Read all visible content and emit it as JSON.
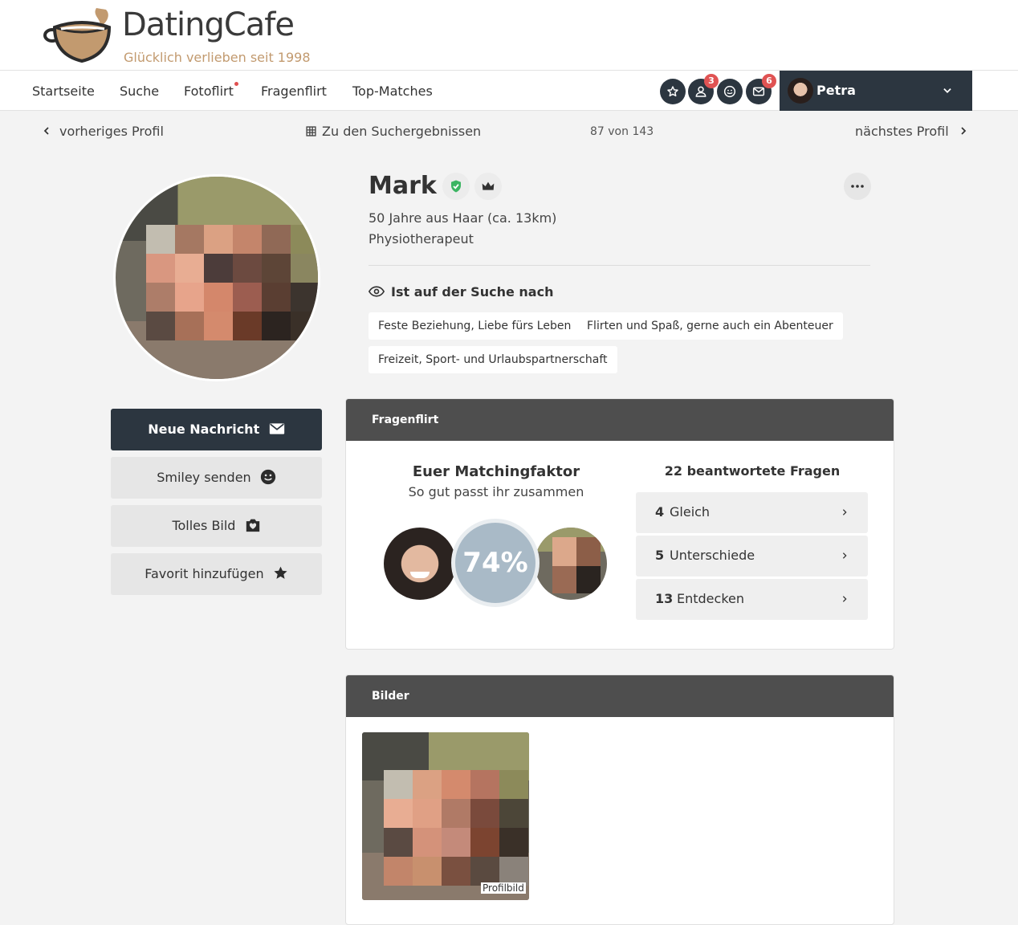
{
  "brand": {
    "name": "DatingCafe",
    "tagline": "Glücklich verlieben seit 1998"
  },
  "nav": {
    "items": [
      {
        "label": "Startseite"
      },
      {
        "label": "Suche"
      },
      {
        "label": "Fotoflirt"
      },
      {
        "label": "Fragenflirt"
      },
      {
        "label": "Top-Matches"
      }
    ],
    "icons": [
      {
        "name": "star-icon",
        "badge": ""
      },
      {
        "name": "user-icon",
        "badge": "3"
      },
      {
        "name": "smiley-icon",
        "badge": ""
      },
      {
        "name": "mail-icon",
        "badge": "6"
      }
    ],
    "user": {
      "name": "Petra"
    }
  },
  "subnav": {
    "prev": "vorheriges Profil",
    "results": "Zu den Suchergebnissen",
    "count": "87 von 143",
    "next": "nächstes Profil"
  },
  "profile": {
    "name": "Mark",
    "age_location": "50 Jahre aus Haar (ca. 13km)",
    "job": "Physiotherapeut",
    "search_heading": "Ist auf der Suche nach",
    "tags": [
      "Feste Beziehung, Liebe fürs Leben",
      "Flirten und Spaß, gerne auch ein Abenteuer",
      "Freizeit, Sport- und Urlaubspartnerschaft"
    ]
  },
  "actions": {
    "message": "Neue Nachricht",
    "smiley": "Smiley senden",
    "photo": "Tolles Bild",
    "favorite": "Favorit hinzufügen"
  },
  "fragenflirt": {
    "header": "Fragenflirt",
    "title": "Euer Matchingfaktor",
    "subtitle": "So gut passt ihr zusammen",
    "percent": "74%",
    "answered": "22 beantwortete Fragen",
    "rows": [
      {
        "num": "4",
        "label": "Gleich"
      },
      {
        "num": "5",
        "label": "Unterschiede"
      },
      {
        "num": "13",
        "label": "Entdecken"
      }
    ]
  },
  "bilder": {
    "header": "Bilder",
    "caption": "Profilbild"
  },
  "colors": {
    "dark": "#2c3640",
    "badge": "#e05353",
    "accent_brown": "#c29a6f",
    "verify_green": "#3cb563"
  }
}
